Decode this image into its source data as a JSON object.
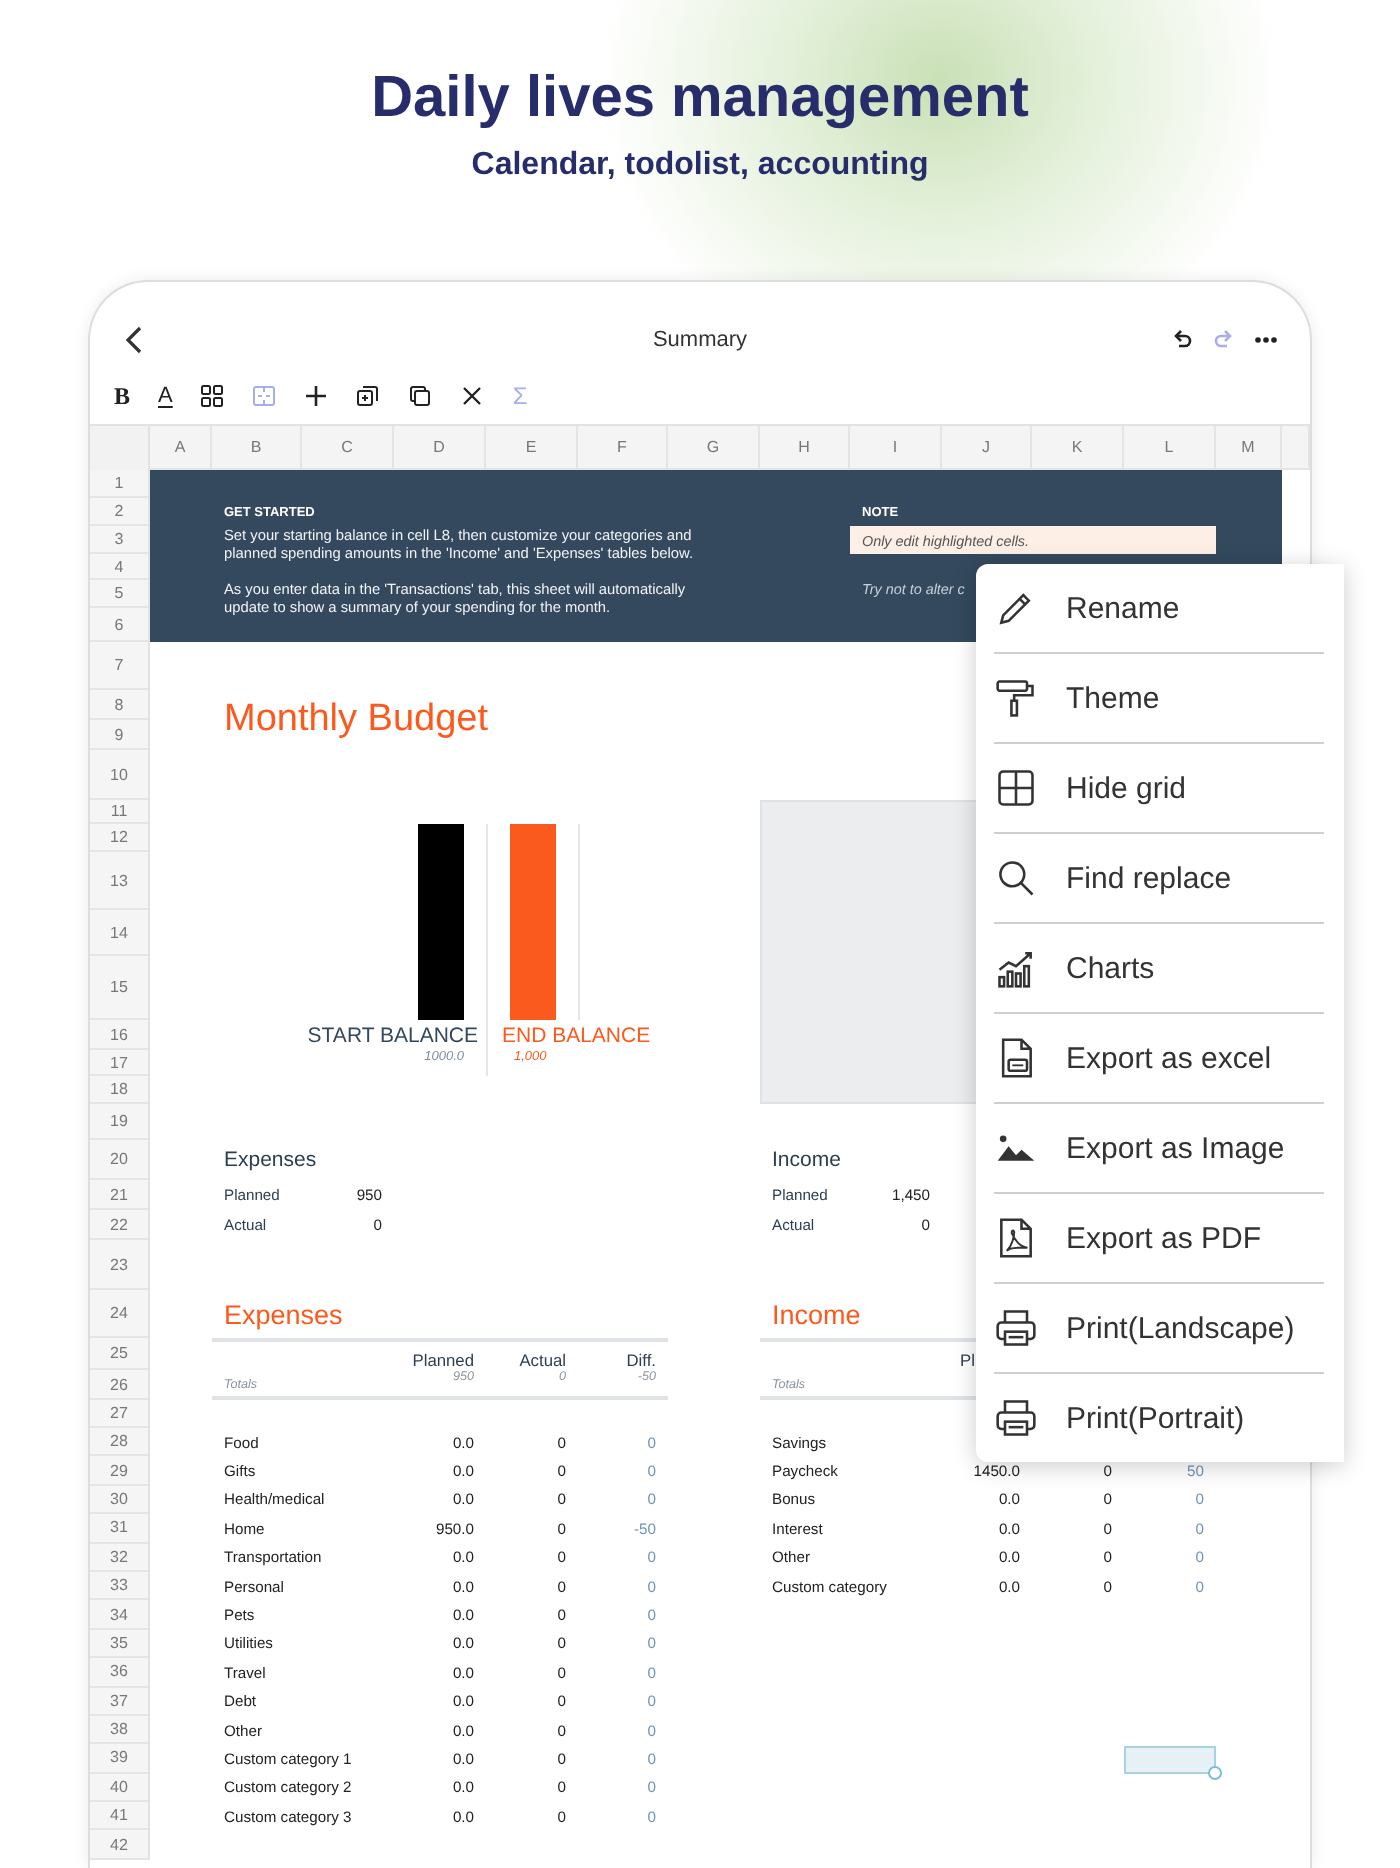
{
  "header": {
    "title": "Daily lives management",
    "subtitle": "Calendar, todolist, accounting"
  },
  "nav": {
    "title": "Summary",
    "back": {
      "kind": "back"
    },
    "actions": [
      {
        "kind": "undo",
        "disabled": false
      },
      {
        "kind": "redo",
        "disabled": true
      },
      {
        "kind": "more",
        "disabled": false
      }
    ]
  },
  "toolbar": [
    {
      "kind": "bold",
      "glyph": "B",
      "disabled": false
    },
    {
      "kind": "text-color",
      "glyph": "A",
      "disabled": false
    },
    {
      "kind": "grid",
      "disabled": false
    },
    {
      "kind": "merge",
      "disabled": true
    },
    {
      "kind": "add",
      "disabled": false
    },
    {
      "kind": "duplicate",
      "disabled": false
    },
    {
      "kind": "copy",
      "disabled": false
    },
    {
      "kind": "delete",
      "disabled": false
    },
    {
      "kind": "sum",
      "glyph": "Σ",
      "disabled": true
    }
  ],
  "columns": [
    "A",
    "B",
    "C",
    "D",
    "E",
    "F",
    "G",
    "H",
    "I",
    "J",
    "K",
    "L",
    "M"
  ],
  "rows": [
    "1",
    "2",
    "3",
    "4",
    "5",
    "6",
    "7",
    "8",
    "9",
    "10",
    "11",
    "12",
    "13",
    "14",
    "15",
    "16",
    "17",
    "18",
    "19",
    "20",
    "21",
    "22",
    "23",
    "24",
    "25",
    "26",
    "27",
    "28",
    "29",
    "30",
    "31",
    "32",
    "33",
    "34",
    "35",
    "36",
    "37",
    "38",
    "39",
    "40",
    "41",
    "42"
  ],
  "banner": {
    "heading": "GET STARTED",
    "paragraphs": [
      "Set your starting balance in cell L8, then customize your categories and planned spending amounts in the 'Income' and 'Expenses' tables below.",
      "As you enter data in the 'Transactions' tab, this sheet will automatically update to show a summary of your spending for the month."
    ],
    "note_heading": "NOTE",
    "note_highlight": "Only edit highlighted cells.",
    "note_text": "Try not to alter c"
  },
  "budget_title": "Monthly Budget",
  "balance_bars": [
    {
      "label": "START BALANCE",
      "value": "1000.0",
      "color": "#000000"
    },
    {
      "label": "END BALANCE",
      "value": "1,000",
      "color": "#fa5a1e"
    }
  ],
  "summaries": [
    {
      "title": "Expenses",
      "rows": [
        {
          "label": "Planned",
          "value": "950"
        },
        {
          "label": "Actual",
          "value": "0"
        }
      ]
    },
    {
      "title": "Income",
      "rows": [
        {
          "label": "Planned",
          "value": "1,450"
        },
        {
          "label": "Actual",
          "value": "0"
        }
      ]
    }
  ],
  "expenses_table": {
    "title": "Expenses",
    "columns": [
      "Planned",
      "Actual",
      "Diff."
    ],
    "totals_label": "Totals",
    "totals": [
      "950",
      "0",
      "-50"
    ],
    "rows": [
      {
        "category": "Food",
        "planned": "0.0",
        "actual": "0",
        "diff": "0"
      },
      {
        "category": "Gifts",
        "planned": "0.0",
        "actual": "0",
        "diff": "0"
      },
      {
        "category": "Health/medical",
        "planned": "0.0",
        "actual": "0",
        "diff": "0"
      },
      {
        "category": "Home",
        "planned": "950.0",
        "actual": "0",
        "diff": "-50"
      },
      {
        "category": "Transportation",
        "planned": "0.0",
        "actual": "0",
        "diff": "0"
      },
      {
        "category": "Personal",
        "planned": "0.0",
        "actual": "0",
        "diff": "0"
      },
      {
        "category": "Pets",
        "planned": "0.0",
        "actual": "0",
        "diff": "0"
      },
      {
        "category": "Utilities",
        "planned": "0.0",
        "actual": "0",
        "diff": "0"
      },
      {
        "category": "Travel",
        "planned": "0.0",
        "actual": "0",
        "diff": "0"
      },
      {
        "category": "Debt",
        "planned": "0.0",
        "actual": "0",
        "diff": "0"
      },
      {
        "category": "Other",
        "planned": "0.0",
        "actual": "0",
        "diff": "0"
      },
      {
        "category": "Custom category 1",
        "planned": "0.0",
        "actual": "0",
        "diff": "0"
      },
      {
        "category": "Custom category 2",
        "planned": "0.0",
        "actual": "0",
        "diff": "0"
      },
      {
        "category": "Custom category 3",
        "planned": "0.0",
        "actual": "0",
        "diff": "0"
      }
    ]
  },
  "income_table": {
    "title": "Income",
    "columns": [
      "Pl"
    ],
    "totals_label": "Totals",
    "rows": [
      {
        "category": "Savings"
      },
      {
        "category": "Paycheck",
        "planned": "1450.0",
        "actual": "0",
        "diff": "50"
      },
      {
        "category": "Bonus",
        "planned": "0.0",
        "actual": "0",
        "diff": "0"
      },
      {
        "category": "Interest",
        "planned": "0.0",
        "actual": "0",
        "diff": "0"
      },
      {
        "category": "Other",
        "planned": "0.0",
        "actual": "0",
        "diff": "0"
      },
      {
        "category": "Custom category",
        "planned": "0.0",
        "actual": "0",
        "diff": "0"
      }
    ]
  },
  "menu": [
    {
      "kind": "pencil",
      "label": "Rename"
    },
    {
      "kind": "roller",
      "label": "Theme"
    },
    {
      "kind": "grid",
      "label": "Hide grid"
    },
    {
      "kind": "search",
      "label": "Find replace"
    },
    {
      "kind": "chart",
      "label": "Charts"
    },
    {
      "kind": "excel",
      "label": "Export as excel"
    },
    {
      "kind": "image",
      "label": "Export as Image"
    },
    {
      "kind": "pdf",
      "label": "Export as PDF"
    },
    {
      "kind": "printer",
      "label": "Print(Landscape)"
    },
    {
      "kind": "printer",
      "label": "Print(Portrait)"
    }
  ]
}
